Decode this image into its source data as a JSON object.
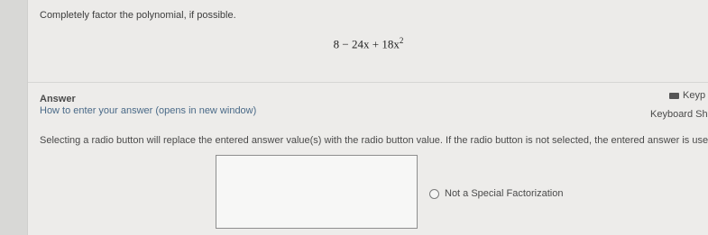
{
  "question": {
    "prompt": "Completely factor the polynomial, if possible.",
    "expression_parts": [
      "8 − 24x + 18x",
      "2"
    ]
  },
  "answer": {
    "title": "Answer",
    "howto_link": "How to enter your answer (opens in new window)",
    "keypad_label": "Keyp",
    "keyboard_shortcuts_label": "Keyboard Shor",
    "instruction": "Selecting a radio button will replace the entered answer value(s) with the radio button value. If the radio button is not selected, the entered answer is used.",
    "input_value": "",
    "radio_option_label": "Not a Special Factorization"
  }
}
